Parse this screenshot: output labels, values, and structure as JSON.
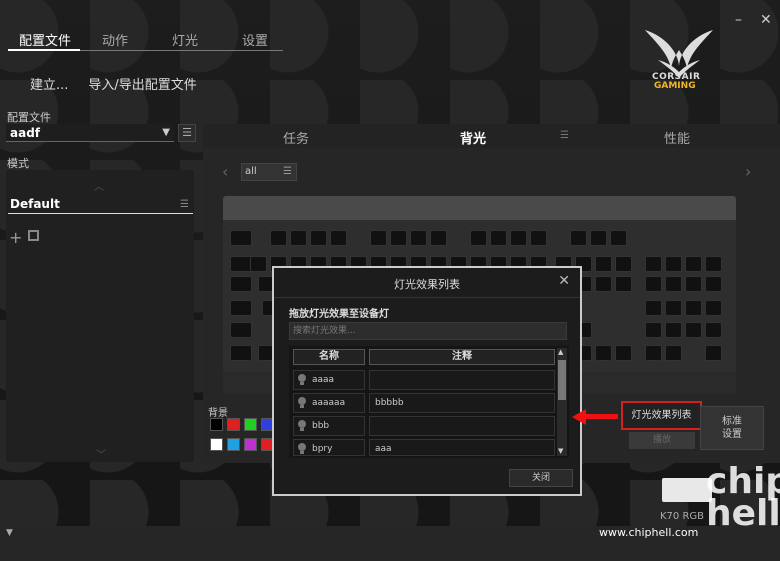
{
  "top_tabs": [
    "配置文件",
    "动作",
    "灯光",
    "设置"
  ],
  "sub_actions": [
    "建立...",
    "导入/导出配置文件"
  ],
  "window": {
    "minimize": "–",
    "close": "✕"
  },
  "brand": {
    "line1": "CORSAIR",
    "line2": "GAMING"
  },
  "profile": {
    "label": "配置文件",
    "value": "aadf"
  },
  "mode": {
    "label": "模式",
    "item": "Default"
  },
  "right_tabs": [
    "任务",
    "背光",
    "性能"
  ],
  "filter": {
    "value": "all"
  },
  "background": {
    "label": "背景",
    "swatches": [
      "#000000",
      "#e02020",
      "#20d020",
      "#3040e0",
      "#ffffff",
      "#20a0e0",
      "#c030d0",
      "#e02020"
    ]
  },
  "dialog": {
    "title": "灯光效果列表",
    "subtitle": "拖放灯光效果至设备灯",
    "search_placeholder": "搜索灯光效果...",
    "col_name": "名称",
    "col_note": "注释",
    "rows": [
      {
        "name": "aaaa",
        "note": ""
      },
      {
        "name": "aaaaaa",
        "note": "bbbbb"
      },
      {
        "name": "bbb",
        "note": ""
      },
      {
        "name": "bpry",
        "note": "aaa"
      }
    ],
    "close_btn": "关闭"
  },
  "fx_button": "灯光效果列表",
  "standard_button": [
    "标准",
    "设置"
  ],
  "play_button": "播放",
  "device": "K70 RGB",
  "site": "www.chiphell.com",
  "watermark": "chip hell",
  "colors": {
    "highlight": "#d62020",
    "accent": "#f2b824"
  }
}
